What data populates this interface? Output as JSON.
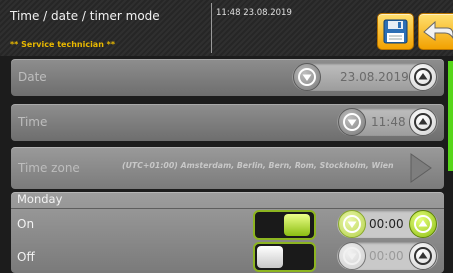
{
  "header": {
    "title": "Time / date / timer mode",
    "role": "** Service technician **",
    "datetime": "11:48 23.08.2019",
    "save_icon": "floppy-disk-icon",
    "back_icon": "back-arrow-icon"
  },
  "rows": {
    "date": {
      "label": "Date",
      "value": "23.08.2019"
    },
    "time": {
      "label": "Time",
      "value": "11:48"
    },
    "timezone": {
      "label": "Time zone",
      "value": "(UTC+01:00) Amsterdam, Berlin, Bern, Rom, Stockholm, Wien"
    }
  },
  "monday": {
    "title": "Monday",
    "on": {
      "label": "On",
      "enabled": true,
      "time": "00:00"
    },
    "off": {
      "label": "Off",
      "enabled": false,
      "time": "00:00"
    }
  },
  "colors": {
    "accent_green": "#8cbe12",
    "header_role": "#e8b800",
    "button_orange": "#f2a100",
    "scrollbar": "#57d61a"
  }
}
